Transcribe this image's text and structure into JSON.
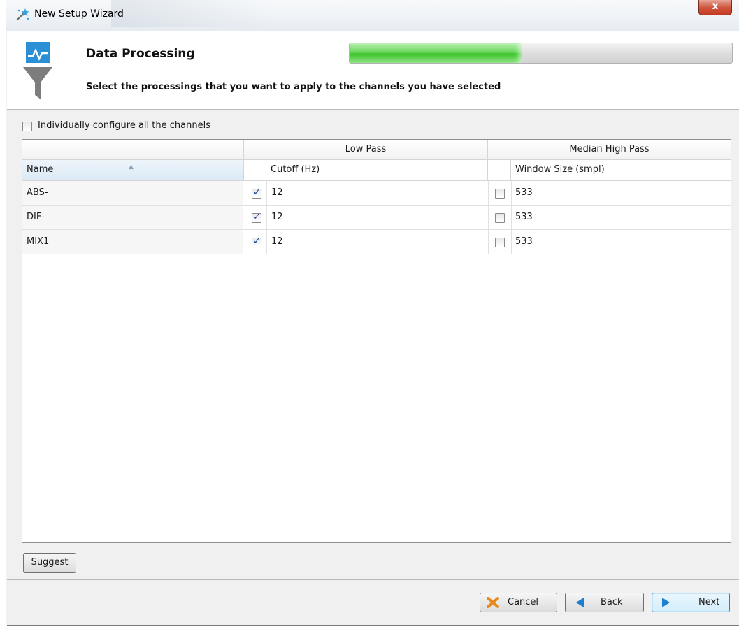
{
  "window": {
    "title": "New Setup Wizard",
    "close_glyph": "x"
  },
  "header": {
    "title": "Data Processing",
    "subtitle": "Select the processings that you want to apply to the channels you have selected",
    "icon": "chart-funnel-icon",
    "progress_fraction": 0.45
  },
  "options": {
    "individually_configure_label": "Individually configure all the channels",
    "individually_configure_checked": false
  },
  "table": {
    "group_headers": {
      "low_pass": "Low Pass",
      "median_high_pass": "Median High Pass"
    },
    "columns": {
      "name": "Name",
      "cutoff": "Cutoff (Hz)",
      "window_size": "Window Size (smpl)"
    },
    "rows": [
      {
        "name": "ABS-",
        "low_pass_enabled": true,
        "cutoff": "12",
        "high_pass_enabled": false,
        "window_size": "533"
      },
      {
        "name": "DIF-",
        "low_pass_enabled": true,
        "cutoff": "12",
        "high_pass_enabled": false,
        "window_size": "533"
      },
      {
        "name": "MIX1",
        "low_pass_enabled": true,
        "cutoff": "12",
        "high_pass_enabled": false,
        "window_size": "533"
      }
    ]
  },
  "buttons": {
    "suggest": "Suggest",
    "cancel": "Cancel",
    "back": "Back",
    "next": "Next"
  },
  "colors": {
    "progress_fill": "#4ccb3c",
    "primary_border": "#3c7fb1",
    "cancel_icon": "#e8891c",
    "nav_icon": "#1e7fd0"
  }
}
